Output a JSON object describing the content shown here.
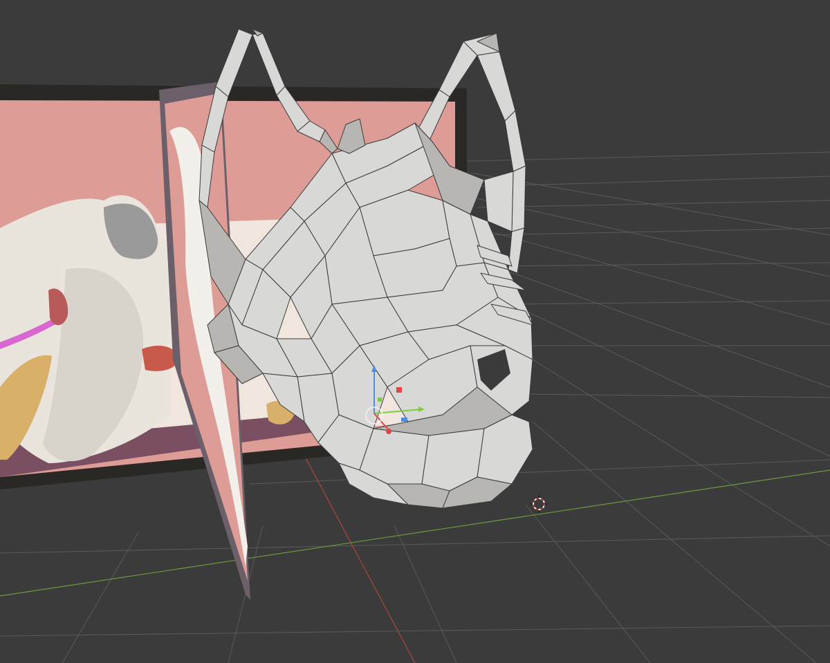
{
  "viewport": {
    "background_color": "#3b3b3b",
    "grid_color": "#4a4a4a",
    "x_axis_color": "#b0463d",
    "y_axis_color": "#6e9a3c"
  },
  "reference_image": {
    "frame_color": "#2a2825",
    "background_color": "#dd9c95",
    "floor_color": "#f0e6de",
    "shadow_color": "#7a4f62"
  },
  "model": {
    "face_color": "#d8d8d6",
    "face_shade_color": "#b8b6b2",
    "edge_color": "#3a3a3a"
  },
  "gizmo": {
    "icon": "transform-gizmo-icon",
    "z_color": "#4a8fe0",
    "y_color": "#7ccf3a",
    "x_color": "#e04848"
  },
  "cursor": {
    "icon": "3d-cursor-icon",
    "color_a": "#c8402f",
    "color_b": "#ffffff"
  }
}
